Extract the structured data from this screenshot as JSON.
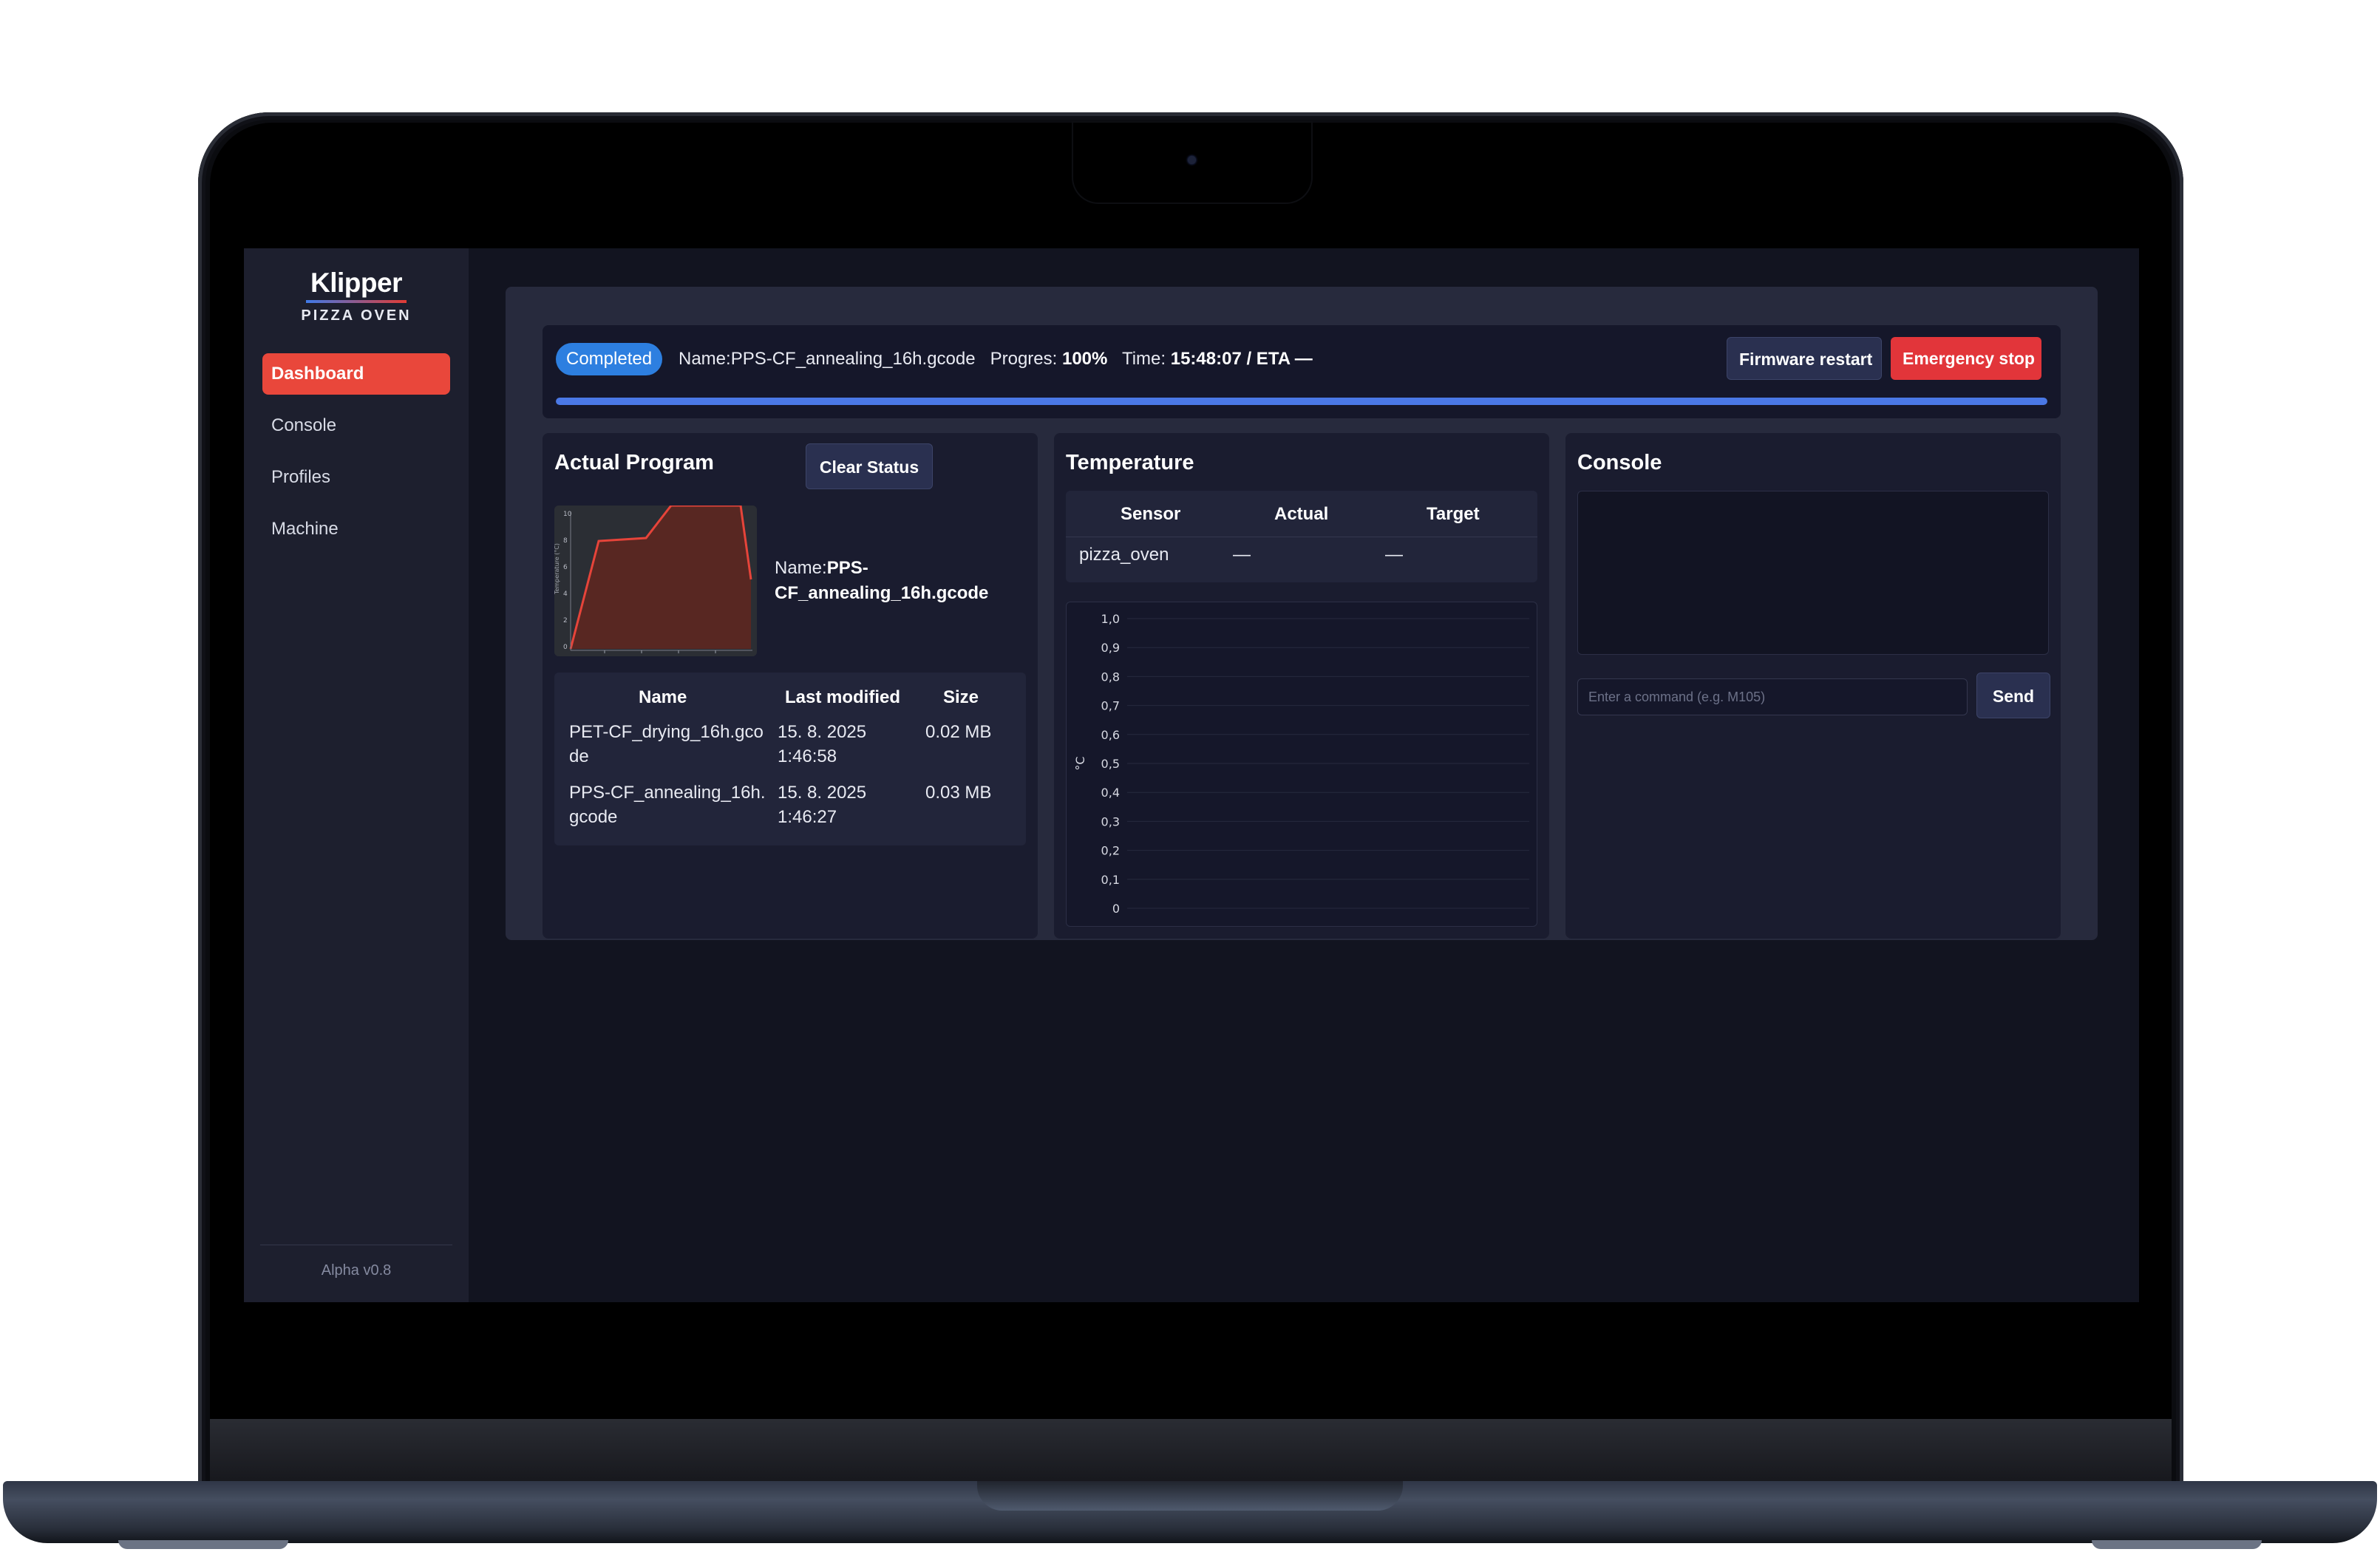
{
  "app": {
    "logo_title": "Klipper",
    "logo_subtitle": "PIZZA OVEN",
    "version": "Alpha v0.8"
  },
  "sidebar": {
    "items": [
      {
        "label": "Dashboard",
        "active": true
      },
      {
        "label": "Console",
        "active": false
      },
      {
        "label": "Profiles",
        "active": false
      },
      {
        "label": "Machine",
        "active": false
      }
    ]
  },
  "status": {
    "badge": "Completed",
    "name_label": "Name:",
    "name_value": "PPS-CF_annealing_16h.gcode",
    "progress_label": "Progres:",
    "progress_value": "100%",
    "progress_fraction": 1.0,
    "time_label": "Time:",
    "time_value": "15:48:07 / ETA —",
    "firmware_restart": "Firmware restart",
    "emergency_stop": "Emergency stop",
    "accent": "#4a78e6",
    "badge_color": "#2d7fe0",
    "stop_color": "#e2353a"
  },
  "program": {
    "title": "Actual Program",
    "clear_status": "Clear Status",
    "name_label": "Name:",
    "name_value": "PPS-CF_annealing_16h.gcode",
    "files_header": {
      "name": "Name",
      "modified": "Last modified",
      "size": "Size"
    },
    "files": [
      {
        "name_l1": "PET-CF_drying_16h.gco",
        "name_l2": "de",
        "mod_l1": "15. 8. 2025",
        "mod_l2": "1:46:58",
        "size": "0.02 MB"
      },
      {
        "name_l1": "PPS-CF_annealing_16h.",
        "name_l2": "gcode",
        "mod_l1": "15. 8. 2025",
        "mod_l2": "1:46:27",
        "size": "0.03 MB"
      }
    ]
  },
  "temperature": {
    "title": "Temperature",
    "header": {
      "sensor": "Sensor",
      "actual": "Actual",
      "target": "Target"
    },
    "rows": [
      {
        "sensor": "pizza_oven",
        "actual": "—",
        "target": "—"
      }
    ]
  },
  "chart_data": {
    "type": "line",
    "ylabel": "°C",
    "ylim": [
      0,
      1.0
    ],
    "y_ticks": [
      "1,0",
      "0,9",
      "0,8",
      "0,7",
      "0,6",
      "0,5",
      "0,4",
      "0,3",
      "0,2",
      "0,1",
      "0"
    ],
    "series": [],
    "grid": true
  },
  "console": {
    "title": "Console",
    "placeholder": "Enter a command (e.g. M105)",
    "send": "Send"
  }
}
